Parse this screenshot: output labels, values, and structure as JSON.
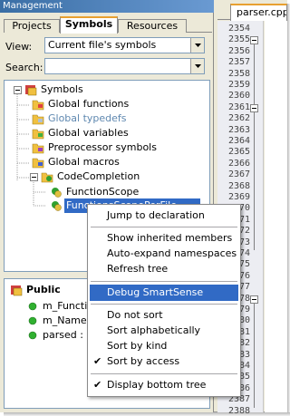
{
  "panel": {
    "title": "Management",
    "tabs": [
      "Projects",
      "Symbols",
      "Resources"
    ],
    "active_tab": "Symbols",
    "view_label": "View:",
    "view_value": "Current file's symbols",
    "search_label": "Search:",
    "search_value": ""
  },
  "tree": {
    "root": "Symbols",
    "items": [
      {
        "label": "Global functions",
        "icon": "global-functions-icon"
      },
      {
        "label": "Global typedefs",
        "icon": "global-typedefs-icon",
        "color": "#5f88b0"
      },
      {
        "label": "Global variables",
        "icon": "global-variables-icon"
      },
      {
        "label": "Preprocessor symbols",
        "icon": "preprocessor-icon"
      },
      {
        "label": "Global macros",
        "icon": "global-macros-icon"
      },
      {
        "label": "CodeCompletion",
        "icon": "namespace-icon"
      },
      {
        "label": "FunctionScope",
        "icon": "class-icon"
      },
      {
        "label": "FunctionsScopePerFile",
        "icon": "class-icon"
      }
    ]
  },
  "bottom_tree": {
    "header": "Public",
    "items": [
      "m_Functio",
      "m_NameS",
      "parsed : b"
    ]
  },
  "editor": {
    "tab": "parser.cpp",
    "line_numbers": [
      "2354",
      "2355",
      "2356",
      "2357",
      "2358",
      "2359",
      "2360",
      "2361",
      "2362",
      "2363",
      "2364",
      "2365",
      "2366",
      "2367",
      "2368",
      "2369",
      "2370",
      "2371",
      "2372",
      "2373",
      "2374",
      "2375",
      "2376",
      "2377",
      "2378",
      "2379",
      "2380",
      "2381",
      "2382",
      "2383",
      "2384",
      "2385",
      "2386",
      "2387",
      "2388"
    ]
  },
  "context_menu": {
    "items": [
      "Jump to declaration",
      "Show inherited members",
      "Auto-expand namespaces",
      "Refresh tree",
      "Debug SmartSense",
      "Do not sort",
      "Sort alphabetically",
      "Sort by kind",
      "Sort by access",
      "Display bottom tree"
    ],
    "highlighted": "Debug SmartSense",
    "checked": [
      "Sort by access",
      "Display bottom tree"
    ]
  },
  "colors": {
    "highlight": "#316ac5",
    "tab_accent": "#e8a030"
  }
}
